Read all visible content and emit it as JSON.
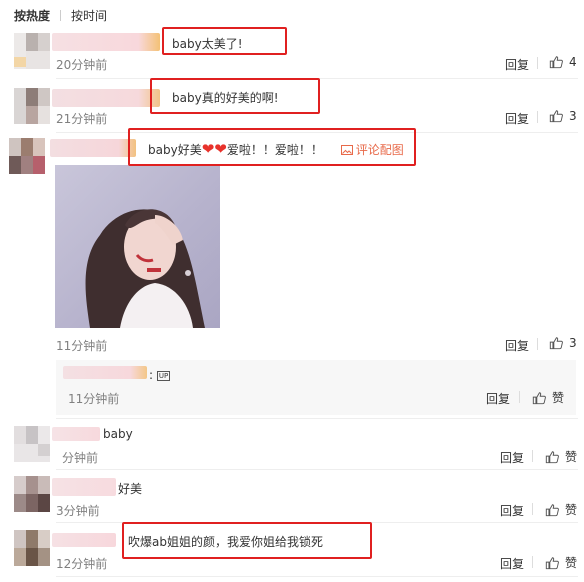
{
  "sort": {
    "hot": "按热度",
    "time": "按时间"
  },
  "labels": {
    "reply": "回复",
    "like": "赞",
    "comment_pic": "评论配图"
  },
  "comments": [
    {
      "text": "baby太美了!",
      "time": "20分钟前",
      "likes": "4"
    },
    {
      "text": "baby真的好美的啊!",
      "time": "21分钟前",
      "likes": "3"
    },
    {
      "text_a": "baby好美",
      "hearts": "❤❤",
      "text_b": "爱啦！！爱啦！！",
      "time": "11分钟前",
      "likes": "3"
    },
    {
      "text": "baby",
      "time": "分钟前",
      "likes": "赞"
    },
    {
      "text": "好美",
      "time": "3分钟前",
      "likes": "赞"
    },
    {
      "text": "吹爆ab姐姐的颜，我爱你姐给我锁死",
      "time": "12分钟前",
      "likes": "赞"
    }
  ],
  "subreply": {
    "colon": ":",
    "tag": "UP",
    "time": "11分钟前",
    "likes": "赞"
  },
  "colors": {
    "accent_red": "#e02020",
    "heart": "#e8322b",
    "link": "#e86a4a"
  }
}
